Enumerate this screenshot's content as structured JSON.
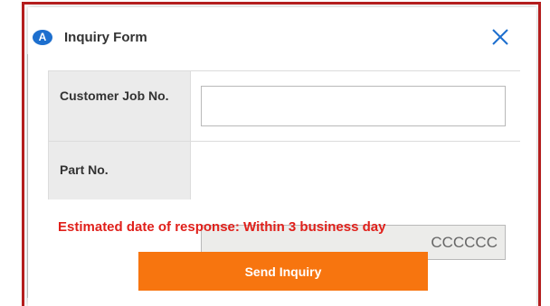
{
  "dialog": {
    "badge_letter": "A",
    "title": "Inquiry Form",
    "close_icon": "close-icon"
  },
  "form": {
    "fields": [
      {
        "label": "Customer Job No.",
        "value": "",
        "placeholder": ""
      },
      {
        "label": "Part No.",
        "value": "CCCCCC",
        "readonly": true
      }
    ]
  },
  "notice": "Estimated date of response: Within 3 business day",
  "send_button_label": "Send Inquiry",
  "colors": {
    "frame": "#b41e1e",
    "badge": "#1d6fce",
    "close_icon": "#1d6fce",
    "notice": "#e0201b",
    "button": "#f7750f"
  }
}
